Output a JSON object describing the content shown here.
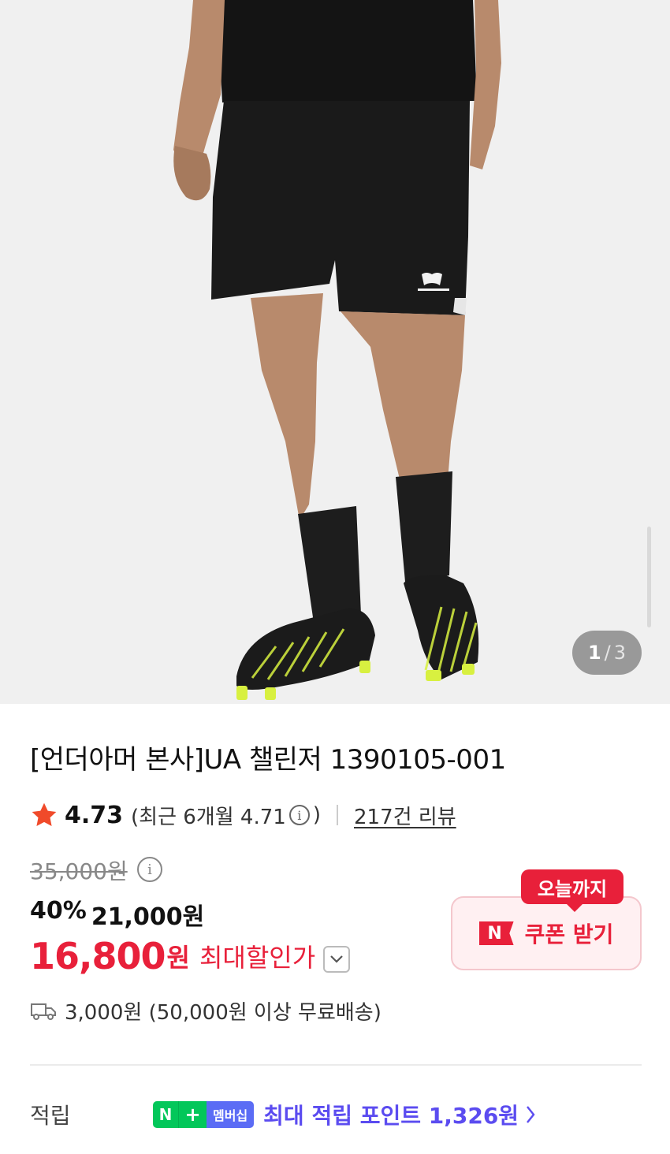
{
  "gallery": {
    "current": "1",
    "separator": "/",
    "total": "3"
  },
  "product": {
    "title": "[언더아머 본사]UA 챌린저 1390105-001"
  },
  "rating": {
    "score": "4.73",
    "recent_prefix": "(최근 6개월 4.71",
    "recent_suffix": ")",
    "review_link": "217건 리뷰"
  },
  "price": {
    "original": "35,000원",
    "discount_percent": "40%",
    "sale_price": "21,000원",
    "final_price": "16,800",
    "final_unit": "원",
    "max_discount_label": "최대할인가"
  },
  "coupon": {
    "badge": "오늘까지",
    "logo": "N",
    "label": "쿠폰 받기"
  },
  "delivery": {
    "text": "3,000원 (50,000원 이상 무료배송)"
  },
  "points": {
    "label": "적립",
    "badge_n": "N",
    "badge_plus": "+",
    "badge_membership": "멤버십",
    "text": "최대 적립 포인트 1,326원"
  },
  "colors": {
    "accent_red": "#e8203a",
    "naver_green": "#03c75a",
    "points_purple": "#5b4cf0",
    "membership_blue": "#5b6cf5"
  }
}
